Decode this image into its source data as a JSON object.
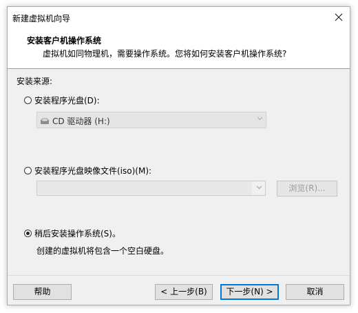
{
  "window": {
    "title": "新建虚拟机向导"
  },
  "header": {
    "title": "安装客户机操作系统",
    "subtitle": "虚拟机如同物理机，需要操作系统。您将如何安装客户机操作系统?"
  },
  "section_label": "安装来源:",
  "options": {
    "disc": {
      "label": "安装程序光盘(D):",
      "selected": false
    },
    "drive_select": {
      "value": "CD 驱动器 (H:)",
      "icon": "cd-drive-icon"
    },
    "iso": {
      "label": "安装程序光盘映像文件(iso)(M):",
      "selected": false,
      "value": ""
    },
    "browse_label": "浏览(R)...",
    "later": {
      "label": "稍后安装操作系统(S)。",
      "selected": true
    },
    "later_note": "创建的虚拟机将包含一个空白硬盘。"
  },
  "buttons": {
    "help": "帮助",
    "back": "< 上一步(B)",
    "next": "下一步(N) >",
    "cancel": "取消"
  },
  "colors": {
    "accent": "#0078d7",
    "dialog_bg": "#f0f0f0"
  }
}
